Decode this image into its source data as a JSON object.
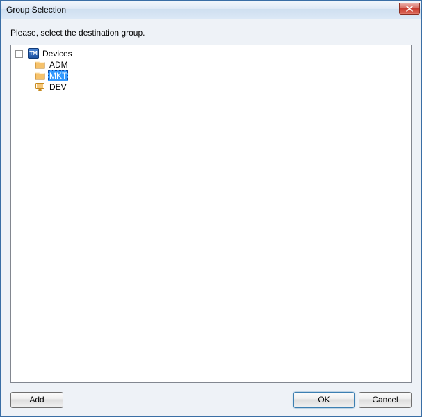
{
  "window": {
    "title": "Group Selection"
  },
  "instruction": "Please, select the destination group.",
  "tree": {
    "root": {
      "label": "Devices",
      "expanded": true,
      "children": [
        {
          "label": "ADM",
          "selected": false,
          "icon": "folder"
        },
        {
          "label": "MKT",
          "selected": true,
          "icon": "folder"
        },
        {
          "label": "DEV",
          "selected": false,
          "icon": "monitor"
        }
      ]
    }
  },
  "buttons": {
    "add": "Add",
    "ok": "OK",
    "cancel": "Cancel"
  },
  "icons": {
    "close": "close-icon",
    "root": "tm-icon",
    "folder": "folder-icon",
    "monitor": "monitor-icon",
    "expand": "minus-box-icon"
  }
}
